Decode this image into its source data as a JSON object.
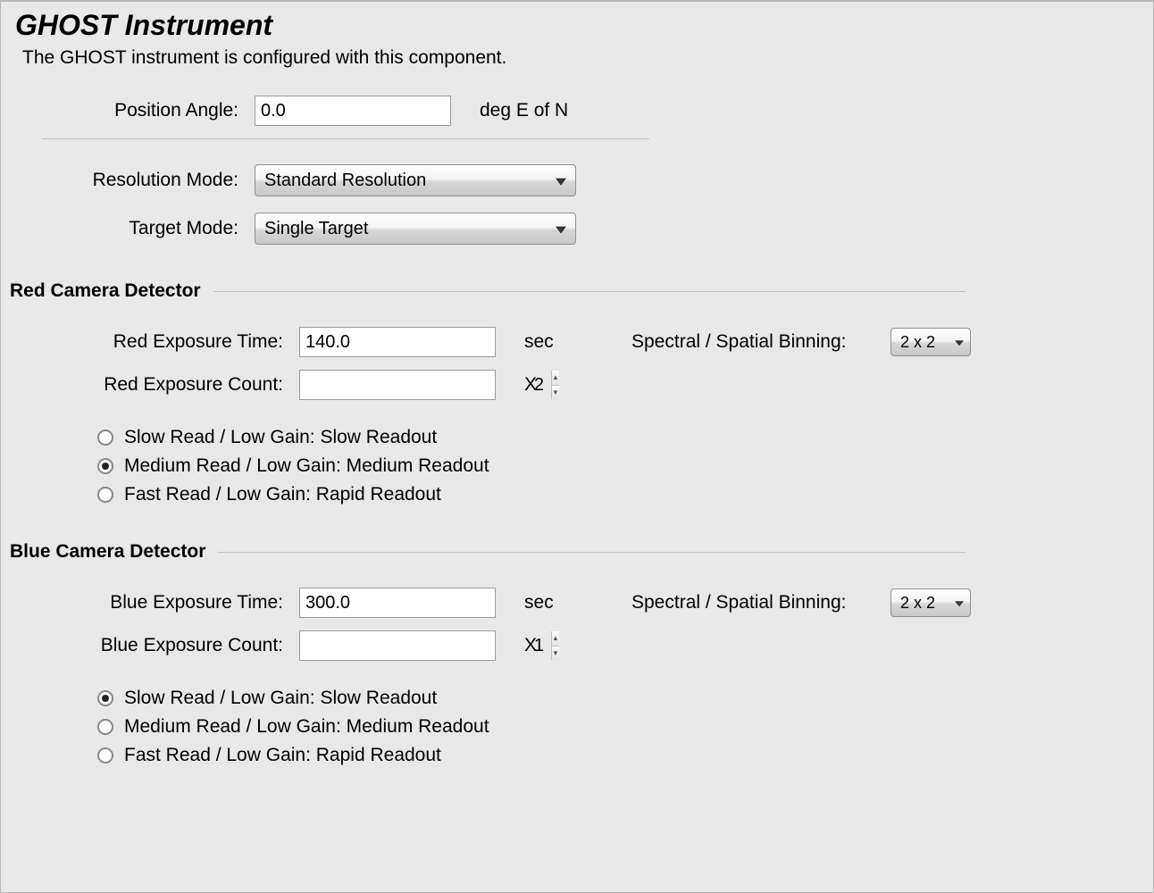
{
  "header": {
    "title": "GHOST Instrument",
    "description": "The GHOST instrument is configured with this component."
  },
  "top": {
    "position_angle_label": "Position Angle:",
    "position_angle_value": "0.0",
    "position_angle_unit": "deg E of N",
    "resolution_mode_label": "Resolution Mode:",
    "resolution_mode_value": "Standard Resolution",
    "target_mode_label": "Target Mode:",
    "target_mode_value": "Single Target"
  },
  "readout_options": [
    "Slow Read / Low Gain: Slow Readout",
    "Medium Read / Low Gain: Medium Readout",
    "Fast Read / Low Gain: Rapid Readout"
  ],
  "red": {
    "section_title": "Red Camera Detector",
    "exposure_time_label": "Red Exposure Time:",
    "exposure_time_value": "140.0",
    "exposure_time_unit": "sec",
    "exposure_count_label": "Red Exposure Count:",
    "exposure_count_value": "2",
    "exposure_count_unit": "X",
    "binning_label": "Spectral / Spatial Binning:",
    "binning_value": "2 x 2",
    "readout_selected_index": 1
  },
  "blue": {
    "section_title": "Blue Camera Detector",
    "exposure_time_label": "Blue Exposure Time:",
    "exposure_time_value": "300.0",
    "exposure_time_unit": "sec",
    "exposure_count_label": "Blue Exposure Count:",
    "exposure_count_value": "1",
    "exposure_count_unit": "X",
    "binning_label": "Spectral / Spatial Binning:",
    "binning_value": "2 x 2",
    "readout_selected_index": 0
  }
}
